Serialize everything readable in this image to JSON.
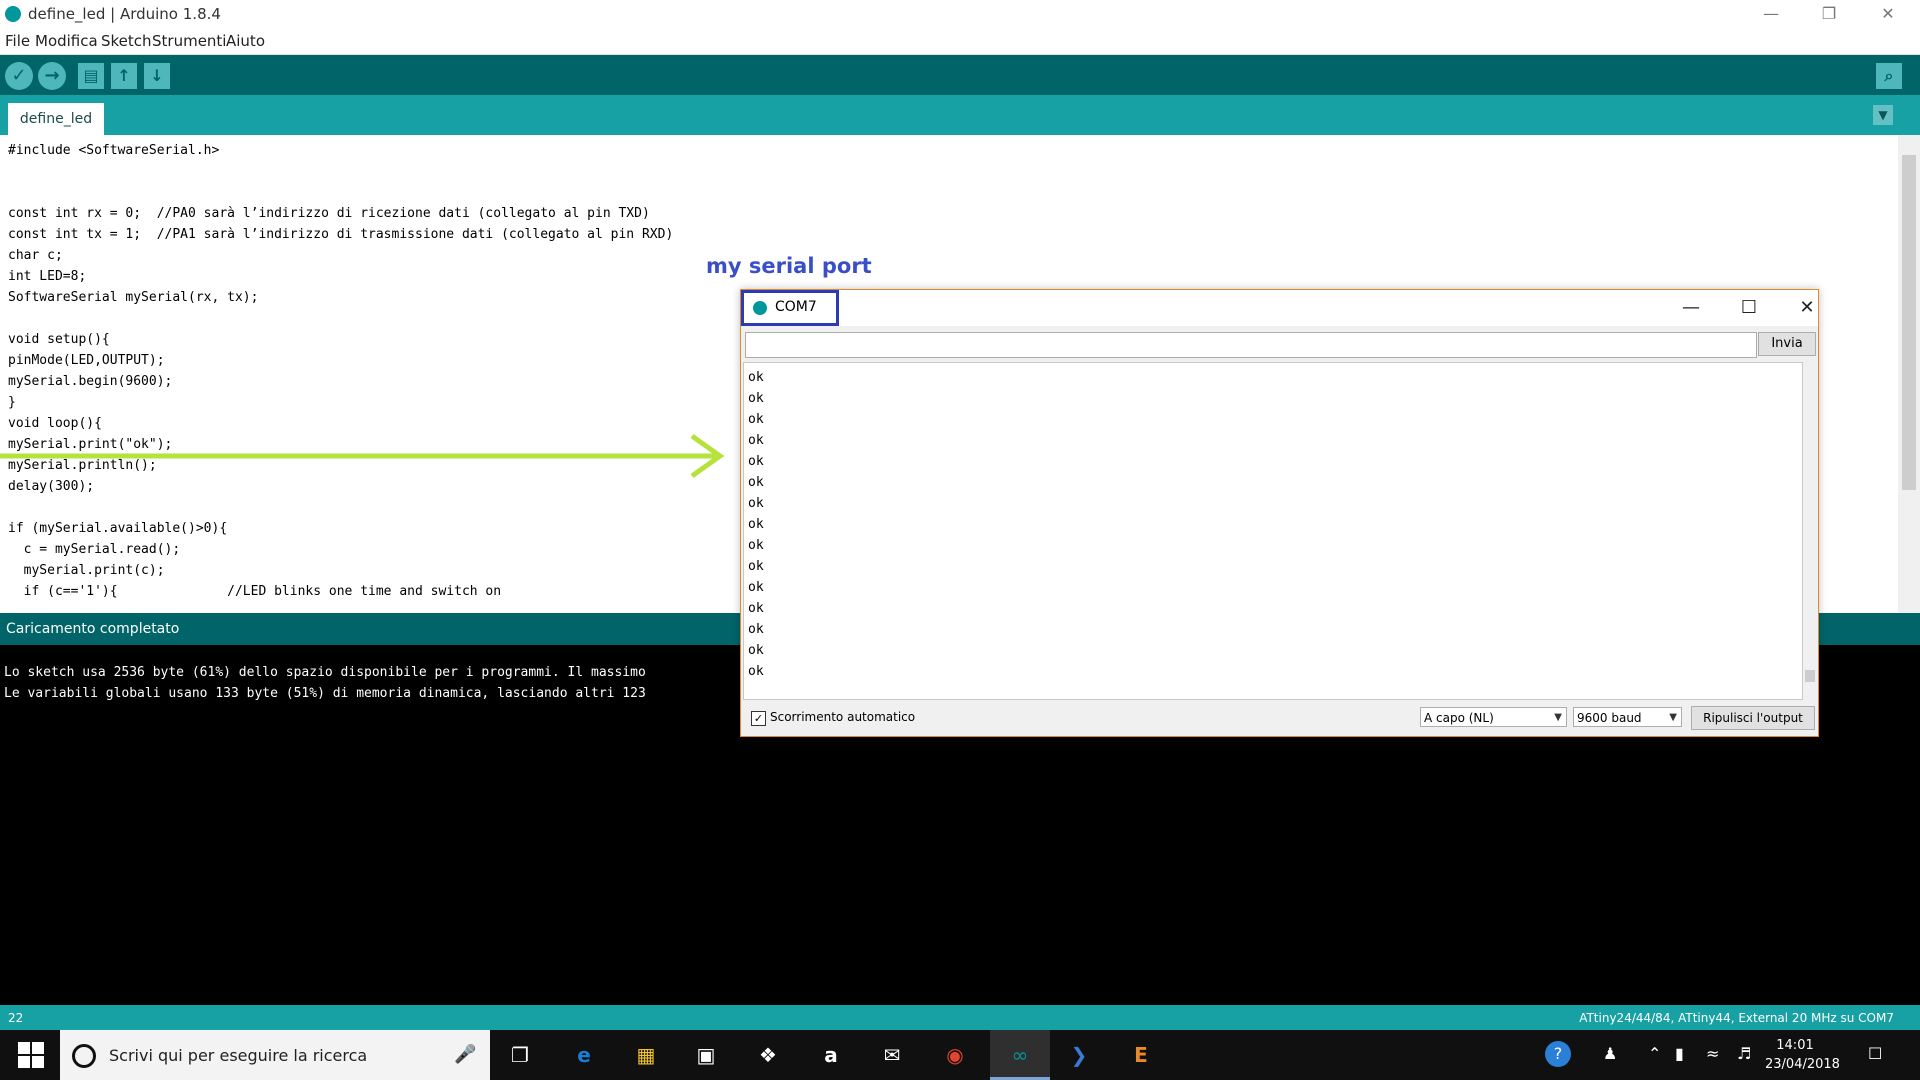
{
  "window": {
    "title": "define_led | Arduino 1.8.4"
  },
  "menu": [
    "File",
    "Modifica",
    "Sketch",
    "Strumenti",
    "Aiuto"
  ],
  "toolbar": {
    "verify": "✓",
    "upload": "→",
    "new": "▤",
    "open": "↑",
    "save": "↓",
    "serial_monitor": "⌕"
  },
  "tabs": [
    {
      "label": "define_led"
    }
  ],
  "editor": {
    "lines": [
      "#include <SoftwareSerial.h>",
      "",
      "",
      "const int rx = 0;  //PA0 sarà l’indirizzo di ricezione dati (collegato al pin TXD)",
      "const int tx = 1;  //PA1 sarà l’indirizzo di trasmissione dati (collegato al pin RXD)",
      "char c;",
      "int LED=8;",
      "SoftwareSerial mySerial(rx, tx);",
      "",
      "void setup(){",
      "pinMode(LED,OUTPUT);",
      "mySerial.begin(9600);",
      "}",
      "void loop(){",
      "mySerial.print(\"ok\");",
      "mySerial.println();",
      "delay(300);",
      "",
      "if (mySerial.available()>0){",
      "  c = mySerial.read();",
      "  mySerial.print(c);",
      "  if (c=='1'){              //LED blinks one time and switch on"
    ]
  },
  "console": {
    "status": "Caricamento completato",
    "lines": [
      "Lo sketch usa 2536 byte (61%) dello spazio disponibile per i programmi. Il massimo",
      "Le variabili globali usano 133 byte (51%) di memoria dinamica, lasciando altri 123"
    ]
  },
  "statusbar": {
    "line_number": "22",
    "board": "ATtiny24/44/84, ATtiny44, External 20 MHz su COM7"
  },
  "annotation": {
    "label": "my serial port",
    "arrow_color": "#b5e23b"
  },
  "serial_monitor": {
    "title": "COM7",
    "input_value": "",
    "send_label": "Invia",
    "output_lines": [
      "ok",
      "ok",
      "ok",
      "ok",
      "ok",
      "ok",
      "ok",
      "ok",
      "ok",
      "ok",
      "ok",
      "ok",
      "ok",
      "ok",
      "ok"
    ],
    "autoscroll_label": "Scorrimento automatico",
    "autoscroll_checked": true,
    "line_ending": "A capo (NL)",
    "baud": "9600 baud",
    "clear_label": "Ripulisci l'output"
  },
  "taskbar": {
    "search_placeholder": "Scrivi qui per eseguire la ricerca",
    "time": "14:01",
    "date": "23/04/2018"
  },
  "colors": {
    "teal_dark": "#006468",
    "teal": "#17a1a5",
    "annotation_blue": "#3a4fc7"
  }
}
